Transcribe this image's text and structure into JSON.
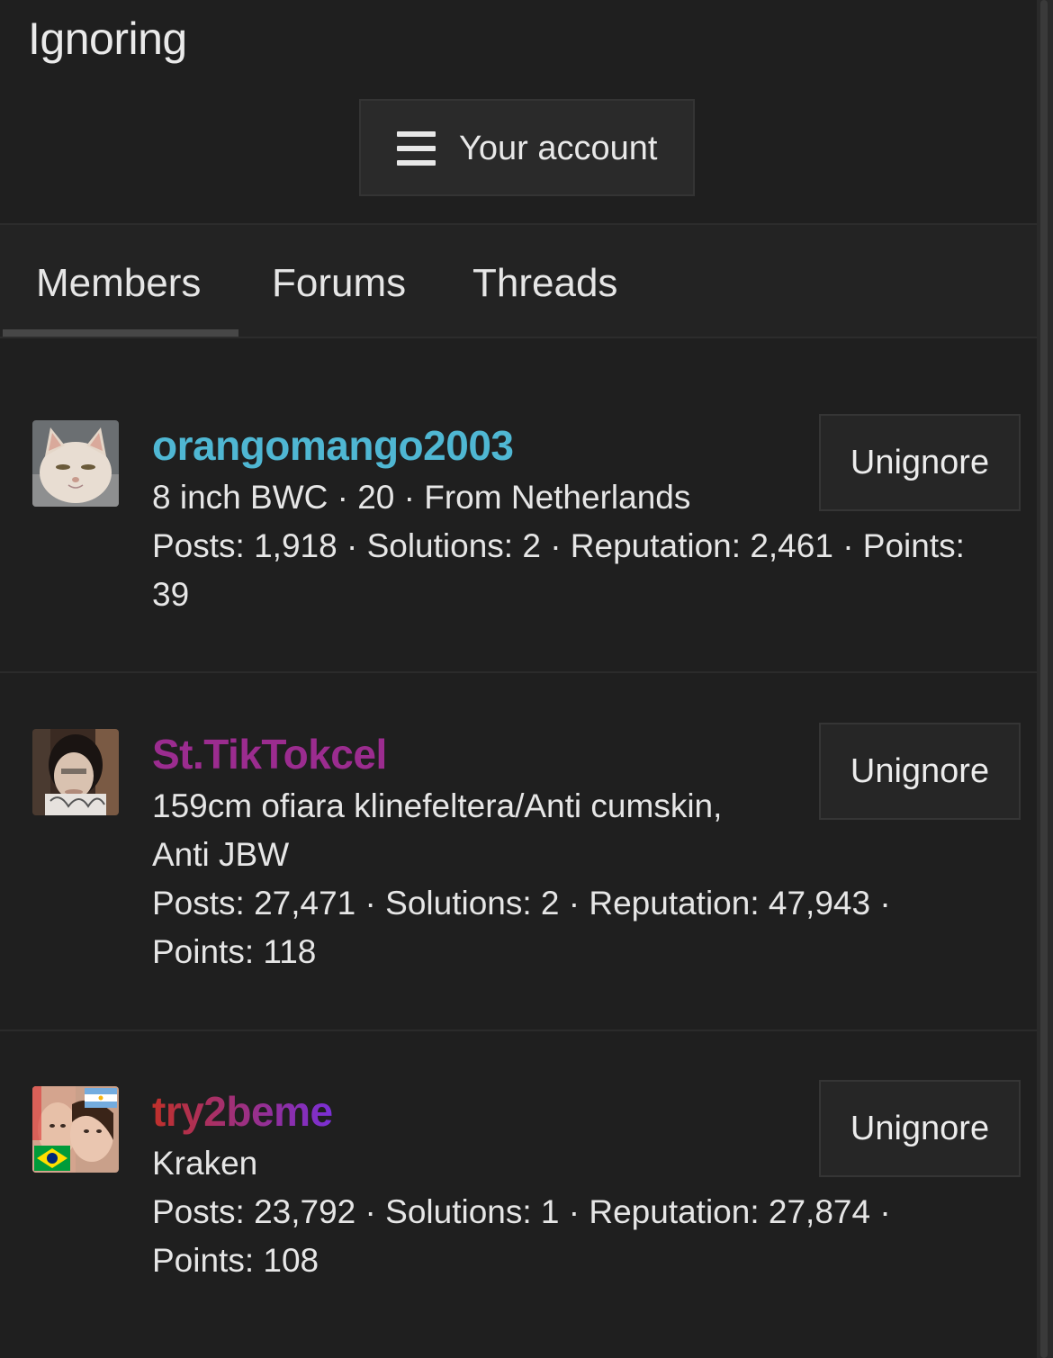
{
  "header": {
    "title": "Ignoring"
  },
  "account_menu": {
    "label": "Your account",
    "icon": "hamburger-icon"
  },
  "tabs": [
    {
      "label": "Members",
      "active": true
    },
    {
      "label": "Forums",
      "active": false
    },
    {
      "label": "Threads",
      "active": false
    }
  ],
  "members": [
    {
      "username": "orangomango2003",
      "username_color": "#4fb7d3",
      "line1": "8 inch BWC · 20 · From Netherlands",
      "line2": "Posts: 1,918 · Solutions: 2 · Reputation: 2,461 · Points:",
      "line3": "39",
      "button": "Unignore"
    },
    {
      "username": "St.TikTokcel",
      "username_color": "#9b2c8f",
      "line1": "159cm ofiara klinefeltera/Anti cumskin,",
      "line2": "Anti JBW",
      "line3": "Posts: 27,471 · Solutions: 2 · Reputation: 47,943 ·",
      "line4": "Points: 118",
      "button": "Unignore"
    },
    {
      "username": "try2beme",
      "username_gradient": [
        "#c0302a",
        "#7a2fd6"
      ],
      "line1": "Kraken",
      "line2": "Posts: 23,792 · Solutions: 1 · Reputation: 27,874 ·",
      "line3": "Points: 108",
      "button": "Unignore"
    }
  ]
}
